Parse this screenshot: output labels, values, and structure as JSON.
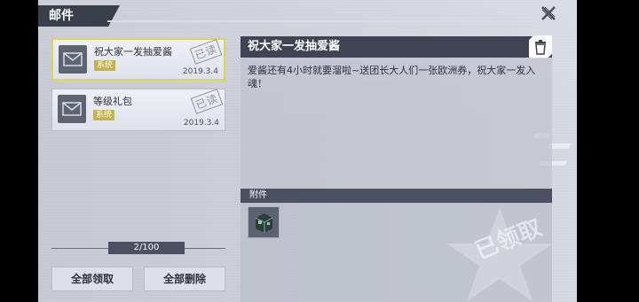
{
  "header": {
    "title": "邮件",
    "close_icon": "close-x-icon"
  },
  "mail_list": [
    {
      "subject": "祝大家一发抽爱酱",
      "tag": "系统",
      "date": "2019.3.4",
      "stamp": "已读",
      "selected": true
    },
    {
      "subject": "等级礼包",
      "tag": "系统",
      "date": "2019.3.4",
      "stamp": "已读",
      "selected": false
    }
  ],
  "pager": {
    "text": "2/100"
  },
  "buttons": {
    "claim_all": "全部领取",
    "delete_all": "全部删除"
  },
  "detail": {
    "title": "祝大家一发抽爱酱",
    "body": "爱酱还有4小时就要溜啦~送团长大人们一张欧洲券，祝大家一发入魂！",
    "trash_icon": "trash-icon"
  },
  "attachment": {
    "label": "附件",
    "claimed_label": "已领取"
  },
  "colors": {
    "header_bg": "#3e4453",
    "tag": "#c4b24a",
    "selected_border": "#e0d35a"
  }
}
